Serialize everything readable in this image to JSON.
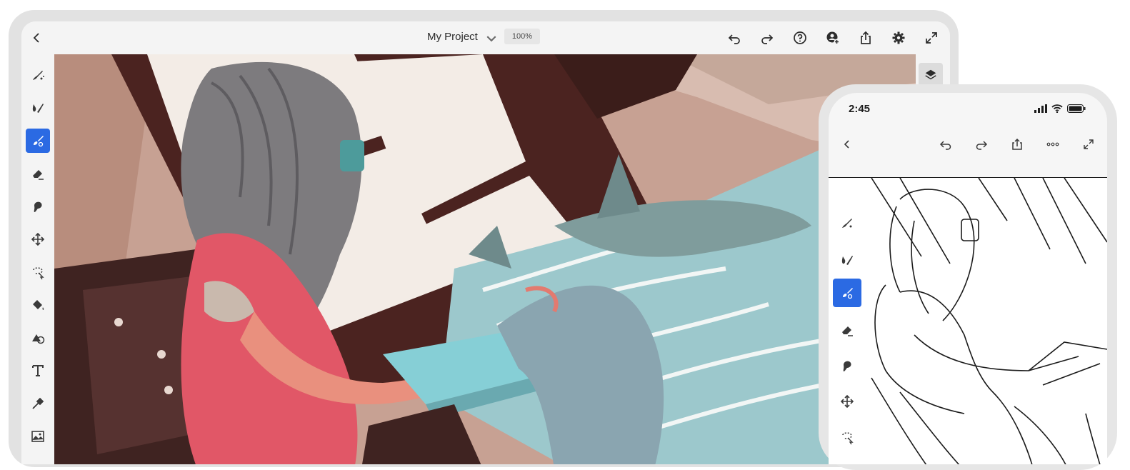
{
  "tablet": {
    "project_title": "My Project",
    "zoom": "100%",
    "topbar_icons": [
      "back-icon",
      "undo-icon",
      "redo-icon",
      "help-icon",
      "invite-user-icon",
      "share-icon",
      "settings-icon",
      "fullscreen-icon"
    ],
    "tools": [
      "smudge-brush-icon",
      "paint-brush-icon",
      "pixel-brush-icon",
      "eraser-icon",
      "blob-icon",
      "move-transform-icon",
      "lasso-select-icon",
      "fill-bucket-icon",
      "shape-icon",
      "text-icon",
      "eyedropper-icon",
      "image-icon"
    ],
    "active_tool": "pixel-brush-icon",
    "right_panel": [
      "layers-icon"
    ],
    "accent_color": "#2b6ae3"
  },
  "phone": {
    "time": "2:45",
    "topbar_icons": [
      "back-icon",
      "undo-icon",
      "redo-icon",
      "share-icon",
      "more-icon",
      "fullscreen-icon"
    ],
    "tools": [
      "smudge-brush-icon",
      "paint-brush-icon",
      "pixel-brush-icon",
      "eraser-icon",
      "blob-icon",
      "move-transform-icon",
      "lasso-select-icon"
    ],
    "active_tool": "pixel-brush-icon"
  }
}
